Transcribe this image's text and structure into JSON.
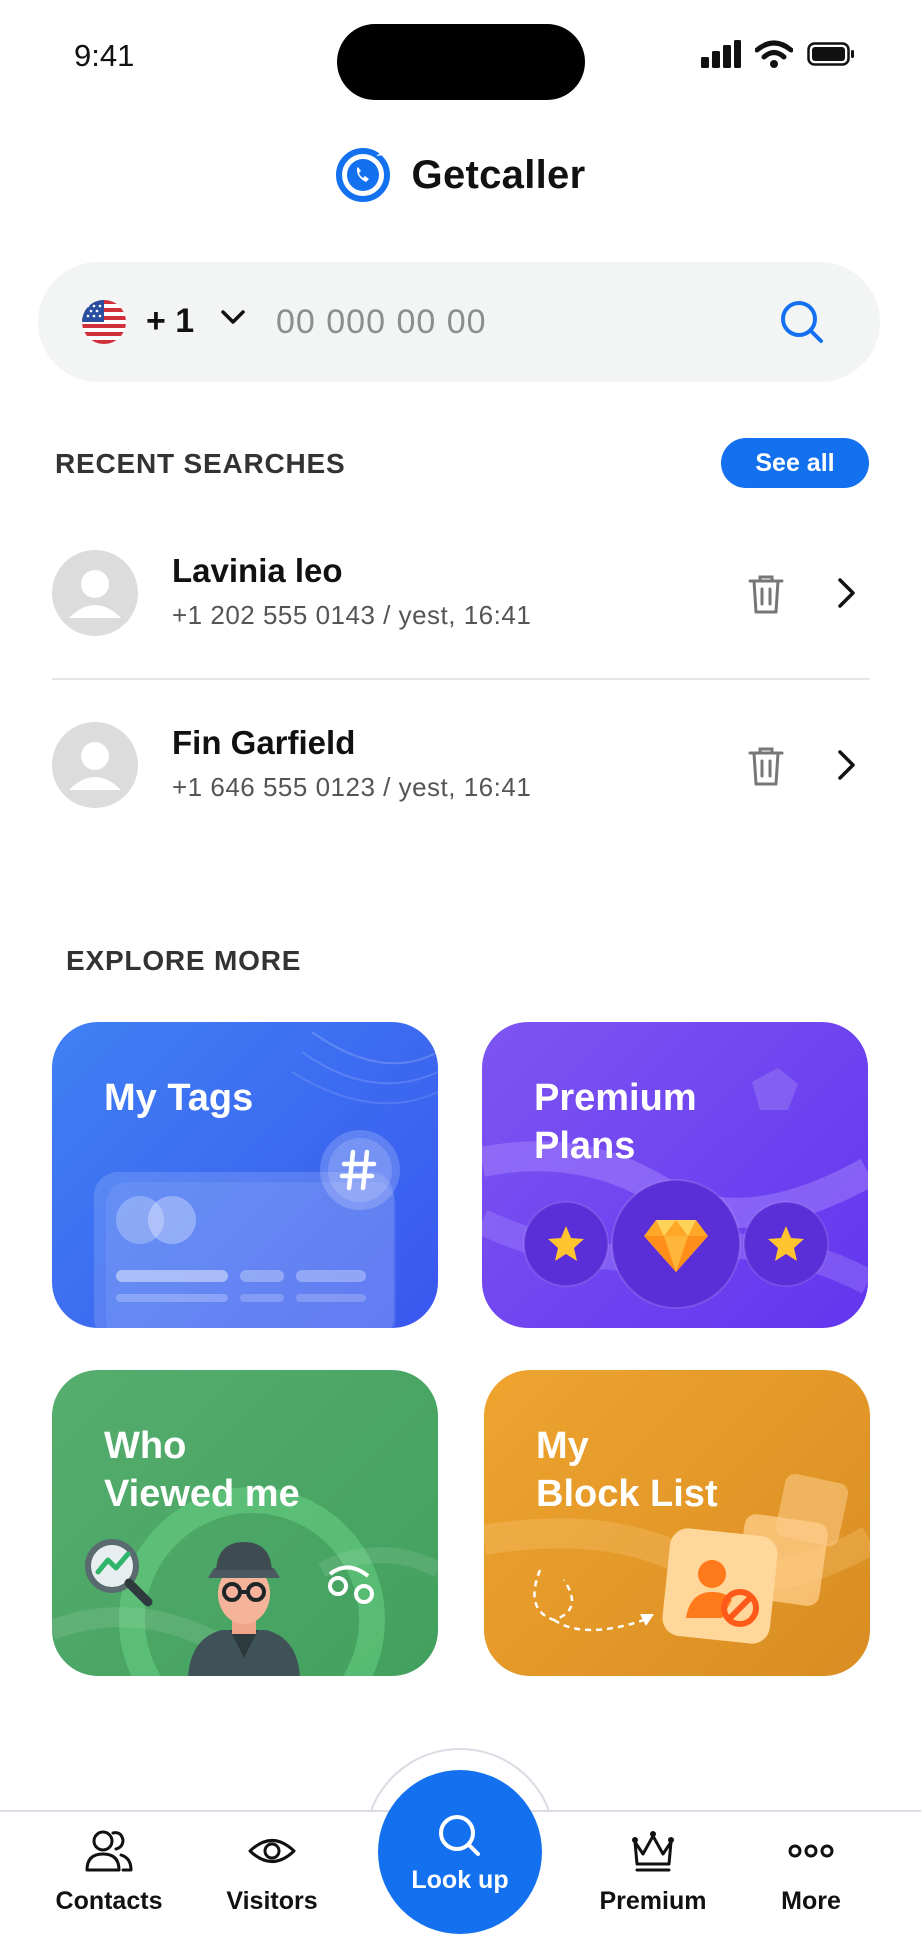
{
  "status_bar": {
    "time": "9:41"
  },
  "header": {
    "title": "Getcaller",
    "logo_icon": "phone-circle-icon",
    "accent": "#1371f0"
  },
  "search": {
    "country_code": "+ 1",
    "flag_icon": "us-flag-icon",
    "placeholder": "00 000 00 00"
  },
  "recent": {
    "title": "RECENT SEARCHES",
    "see_all": "See all",
    "items": [
      {
        "name": "Lavinia leo",
        "meta": "+1 202 555 0143  / yest, 16:41"
      },
      {
        "name": "Fin Garfield",
        "meta": "+1 646 555 0123  / yest, 16:41"
      }
    ]
  },
  "explore": {
    "title": "EXPLORE MORE",
    "cards": [
      {
        "title": "My Tags",
        "color": "#3d6cf2",
        "icon": "hashtag-icon"
      },
      {
        "title": "Premium\nPlans",
        "color": "#6f4ef0",
        "icon": "diamond-icon"
      },
      {
        "title": "Who\nViewed me",
        "color": "#4aa866",
        "icon": "spy-icon"
      },
      {
        "title": "My\nBlock List",
        "color": "#e39a2c",
        "icon": "blocked-user-icon"
      }
    ]
  },
  "nav": {
    "items": [
      {
        "label": "Contacts",
        "icon": "contacts-icon"
      },
      {
        "label": "Visitors",
        "icon": "eye-icon"
      },
      {
        "label": "Look up",
        "icon": "search-icon"
      },
      {
        "label": "Premium",
        "icon": "crown-icon"
      },
      {
        "label": "More",
        "icon": "more-dots-icon"
      }
    ]
  }
}
